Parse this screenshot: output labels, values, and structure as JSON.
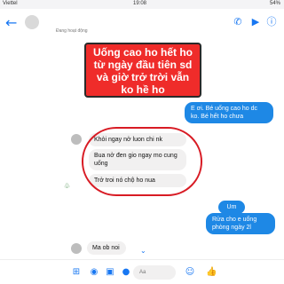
{
  "status_bar": {
    "carrier": "Viettel",
    "time": "19:08",
    "battery": "54%"
  },
  "header": {
    "contact_name": "",
    "contact_status": "Đang hoạt động"
  },
  "callout": {
    "lines": [
      "Uống cao ho hết ho",
      "từ ngày đầu tiên sd",
      "và giờ trở trời vẫn",
      "ko hề ho"
    ]
  },
  "messages": [
    {
      "side": "right",
      "text": "E ơi. Bé uống cao ho dc ko. Bé hết ho chưa"
    },
    {
      "side": "left",
      "text": "Khỏi ngay nở luon chi nk"
    },
    {
      "side": "left",
      "text": "Bua nở đen gio ngay mo cung uống"
    },
    {
      "side": "left",
      "text": "Trở troi nó chộ ho nua"
    },
    {
      "side": "right",
      "text": "Um"
    },
    {
      "side": "right",
      "text": "Rửa cho e uống phòng ngày 2l"
    },
    {
      "side": "left",
      "text": "Ma ob noi"
    }
  ],
  "composer": {
    "placeholder": "Aa"
  },
  "icons": {
    "back": "back-arrow-icon",
    "call": "phone-icon",
    "video": "video-icon",
    "info": "info-icon",
    "menu": "menu-icon",
    "camera": "camera-icon",
    "gallery": "image-icon",
    "mic": "mic-icon",
    "emoji": "emoji-icon",
    "like": "like-icon"
  },
  "colors": {
    "accent": "#1877f2",
    "bubble": "#1e88e5",
    "callout": "#ef2c2a",
    "ring": "#d81b24"
  }
}
